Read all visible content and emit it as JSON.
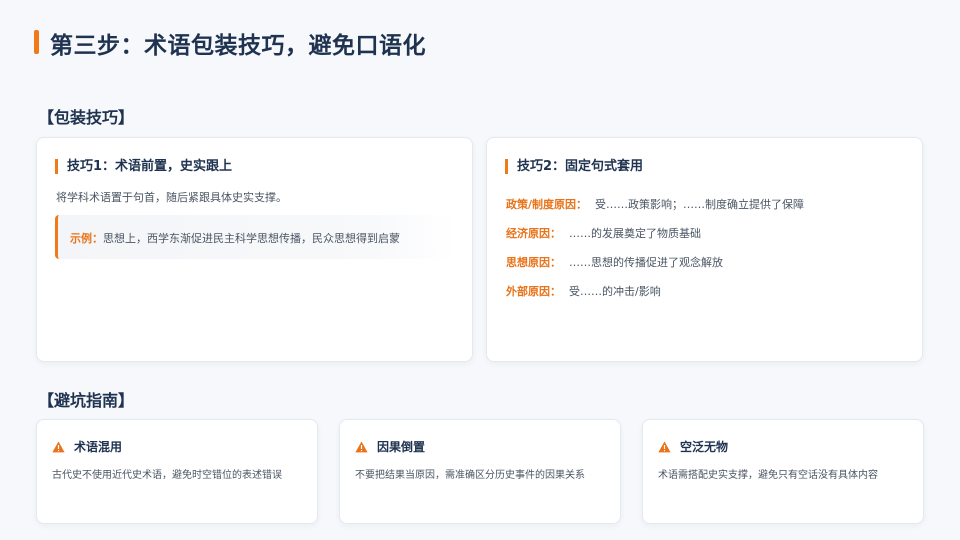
{
  "page": {
    "title": "第三步：术语包装技巧，避免口语化"
  },
  "packaging": {
    "section_title": "【包装技巧】",
    "tip1": {
      "title": "技巧1：术语前置，史实跟上",
      "description": "将学科术语置于句首，随后紧跟具体史实支撑。",
      "example_label": "示例：",
      "example_text": "思想上，西学东渐促进民主科学思想传播，民众思想得到启蒙"
    },
    "tip2": {
      "title": "技巧2：固定句式套用",
      "patterns": [
        {
          "label": "政策/制度原因：",
          "text": "受……政策影响；……制度确立提供了保障"
        },
        {
          "label": "经济原因：",
          "text": "……的发展奠定了物质基础"
        },
        {
          "label": "思想原因：",
          "text": "……思想的传播促进了观念解放"
        },
        {
          "label": "外部原因：",
          "text": "受……的冲击/影响"
        }
      ]
    }
  },
  "pitfalls": {
    "section_title": "【避坑指南】",
    "items": [
      {
        "title": "术语混用",
        "description": "古代史不使用近代史术语，避免时空错位的表述错误"
      },
      {
        "title": "因果倒置",
        "description": "不要把结果当原因，需准确区分历史事件的因果关系"
      },
      {
        "title": "空泛无物",
        "description": "术语需搭配史实支撑，避免只有空话没有具体内容"
      }
    ],
    "icon": "warning-icon"
  },
  "colors": {
    "accent": "#f07a1a",
    "heading": "#1f3350",
    "warning": "#e8731a"
  }
}
